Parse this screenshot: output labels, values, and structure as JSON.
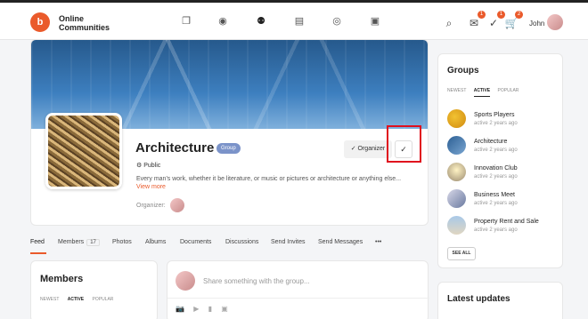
{
  "app": {
    "brand": "Online\nCommunities",
    "logo_text": "b"
  },
  "nav": {
    "items": [
      {
        "name": "activity",
        "icon": "activity-icon",
        "glyph": "❐"
      },
      {
        "name": "profile",
        "icon": "user-icon",
        "glyph": "◉"
      },
      {
        "name": "groups",
        "icon": "groups-icon",
        "glyph": "⚉"
      },
      {
        "name": "messages",
        "icon": "chat-icon",
        "glyph": "▤"
      },
      {
        "name": "photos",
        "icon": "camera-icon",
        "glyph": "◎"
      },
      {
        "name": "documents",
        "icon": "document-icon",
        "glyph": "▣"
      }
    ]
  },
  "header_right": {
    "search_glyph": "⌕",
    "messages_badge": "1",
    "notifications_badge": "1",
    "cart_badge": "2",
    "username": "John"
  },
  "group": {
    "title": "Architecture",
    "type_badge": "Group",
    "privacy": "Public",
    "description": "Every man's work, whether it be literature, or music or pictures or architecture or anything else...",
    "view_more": "View more",
    "organizer_label": "Organizer:",
    "organizer_button": "✓ Organizer",
    "check_button": "✓"
  },
  "tabs": [
    {
      "label": "Feed",
      "active": true
    },
    {
      "label": "Members",
      "count": "17"
    },
    {
      "label": "Photos"
    },
    {
      "label": "Albums"
    },
    {
      "label": "Documents"
    },
    {
      "label": "Discussions"
    },
    {
      "label": "Send Invites"
    },
    {
      "label": "Send Messages"
    },
    {
      "label": "•••"
    }
  ],
  "members_widget": {
    "title": "Members",
    "filters": [
      "NEWEST",
      "ACTIVE",
      "POPULAR"
    ],
    "active_filter": "ACTIVE"
  },
  "post_box": {
    "placeholder": "Share something with the group..."
  },
  "groups_widget": {
    "title": "Groups",
    "filters": [
      "NEWEST",
      "ACTIVE",
      "POPULAR"
    ],
    "active_filter": "ACTIVE",
    "items": [
      {
        "name": "Sports Players",
        "meta": "active 2 years ago"
      },
      {
        "name": "Architecture",
        "meta": "active 2 years ago"
      },
      {
        "name": "Innovation Club",
        "meta": "active 2 years ago"
      },
      {
        "name": "Business Meet",
        "meta": "active 2 years ago"
      },
      {
        "name": "Property Rent and Sale",
        "meta": "active 2 years ago"
      }
    ],
    "see_all": "SEE ALL"
  },
  "latest_widget": {
    "title": "Latest updates"
  },
  "colors": {
    "accent": "#ea5a2b",
    "badge": "#7b93c9",
    "highlight": "#e0101e"
  }
}
